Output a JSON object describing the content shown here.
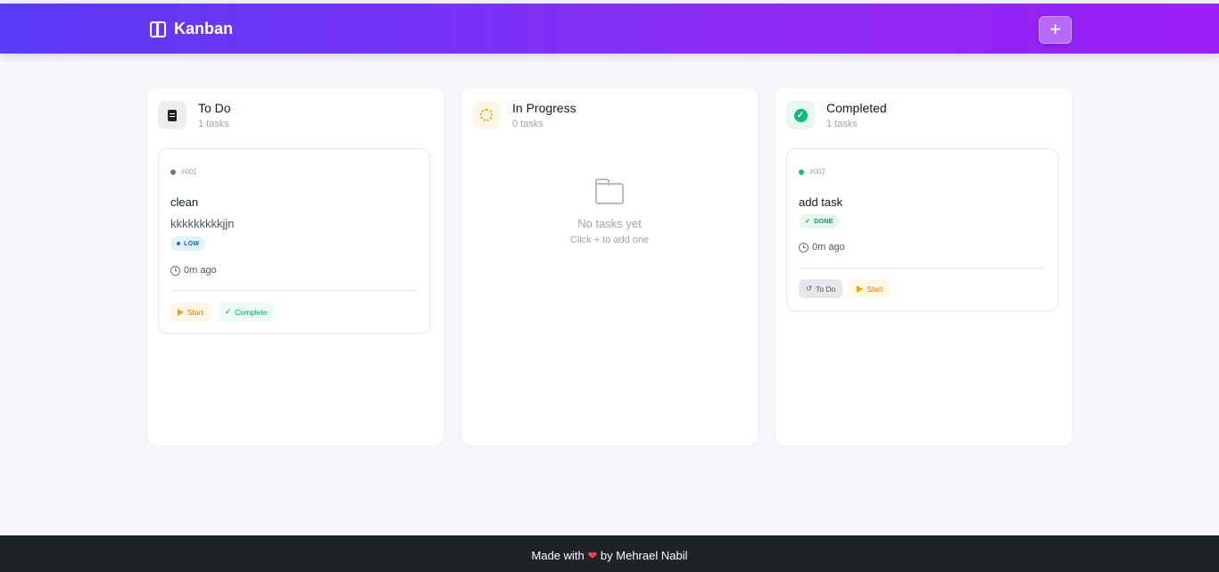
{
  "header": {
    "title": "Kanban",
    "add_label": "+"
  },
  "columns": [
    {
      "title": "To Do",
      "count": "1 tasks"
    },
    {
      "title": "In Progress",
      "count": "0 tasks"
    },
    {
      "title": "Completed",
      "count": "1 tasks"
    }
  ],
  "todo_card": {
    "id": "#001",
    "title": "clean",
    "description": "kkkkkkkkkjjn",
    "priority": "LOW",
    "time": "0m ago",
    "start_label": "Start",
    "complete_label": "Complete"
  },
  "progress_empty": {
    "title": "No tasks yet",
    "subtitle": "Click + to add one"
  },
  "done_card": {
    "id": "#002",
    "title": "add task",
    "status": "DONE",
    "time": "0m ago",
    "todo_label": "To Do",
    "start_label": "Start"
  },
  "footer": {
    "prefix": "Made with",
    "heart": "❤",
    "suffix": "by Mehrael Nabil"
  }
}
